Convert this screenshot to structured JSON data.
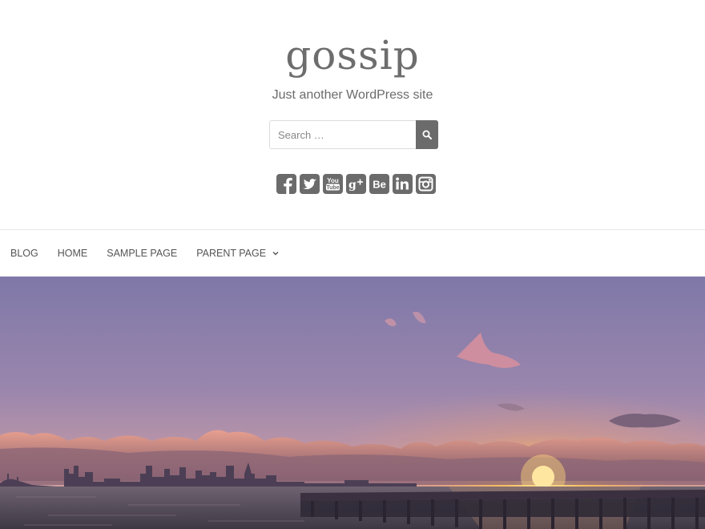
{
  "site": {
    "title": "gossip",
    "description": "Just another WordPress site"
  },
  "search": {
    "placeholder": "Search …",
    "button_icon": "search-icon"
  },
  "social": [
    {
      "name": "facebook-icon",
      "glyph": "f"
    },
    {
      "name": "twitter-icon",
      "glyph": "t"
    },
    {
      "name": "youtube-icon",
      "glyph": "You Tube"
    },
    {
      "name": "google-plus-icon",
      "glyph": "g+"
    },
    {
      "name": "behance-icon",
      "glyph": "Be"
    },
    {
      "name": "linkedin-icon",
      "glyph": "in"
    },
    {
      "name": "instagram-icon",
      "glyph": "ig"
    }
  ],
  "nav": {
    "items": [
      {
        "label": "BLOG"
      },
      {
        "label": "HOME"
      },
      {
        "label": "SAMPLE PAGE"
      },
      {
        "label": "PARENT PAGE",
        "has_dropdown": true
      }
    ]
  },
  "colors": {
    "icon_gray": "#6b6b6b",
    "sky_top": "#8a7eab",
    "sun": "#ffd27a"
  }
}
